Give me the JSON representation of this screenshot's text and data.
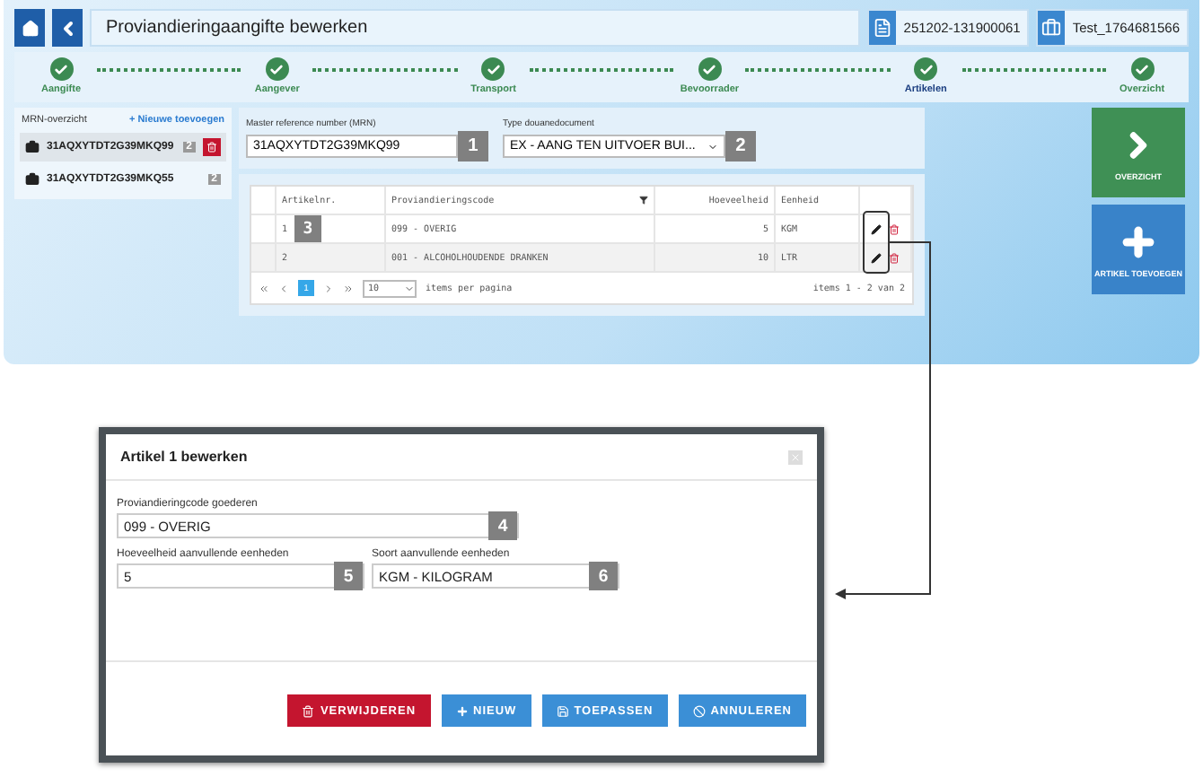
{
  "header": {
    "title": "Proviandieringaangifte bewerken",
    "document_number": "251202-131900061",
    "user": "Test_1764681566"
  },
  "steps": [
    {
      "label": "Aangifte",
      "selected": false
    },
    {
      "label": "Aangever",
      "selected": false
    },
    {
      "label": "Transport",
      "selected": false
    },
    {
      "label": "Bevoorrader",
      "selected": false
    },
    {
      "label": "Artikelen",
      "selected": true
    },
    {
      "label": "Overzicht",
      "selected": false
    }
  ],
  "sidebar": {
    "title": "MRN-overzicht",
    "add_link": "+ Nieuwe toevoegen",
    "items": [
      {
        "mrn": "31AQXYTDT2G39MKQ99",
        "count": "2",
        "selected": true
      },
      {
        "mrn": "31AQXYTDT2G39MKQ55",
        "count": "2",
        "selected": false
      }
    ]
  },
  "form": {
    "fields": [
      {
        "kind": "text",
        "label": "Master reference number (MRN)",
        "value": "31AQXYTDT2G39MKQ99",
        "marker": "1"
      },
      {
        "kind": "select",
        "label": "Type douanedocument",
        "value": "EX - AANG TEN UITVOER BUI...",
        "marker": "2"
      }
    ]
  },
  "table": {
    "columns": [
      {},
      {
        "label": "Artikelnr."
      },
      {
        "label": "Proviandieringscode",
        "filter": true
      },
      {
        "label": "Hoeveelheid"
      },
      {
        "label": "Eenheid"
      },
      {}
    ],
    "rows": [
      {
        "number": "1",
        "marker": "3",
        "code": "099 - OVERIG",
        "quantity": "5",
        "unit": "KGM"
      },
      {
        "number": "2",
        "code": "001 - ALCOHOLHOUDENDE DRANKEN",
        "quantity": "10",
        "unit": "LTR"
      }
    ],
    "pagination": {
      "pages": [
        {
          "label": "1",
          "selected": true
        }
      ],
      "page_size": "10",
      "per_page_label": "items per pagina",
      "summary": "items 1 - 2 van 2"
    }
  },
  "actions": [
    {
      "kind": "next",
      "label": "OVERZICHT"
    },
    {
      "kind": "add",
      "label": "ARTIKEL TOEVOEGEN"
    }
  ],
  "dialog": {
    "title": "Artikel 1 bewerken",
    "fields": [
      {
        "label": "Proviandieringcode goederen",
        "value": "099 - OVERIG",
        "marker": "4"
      },
      {
        "label": "Hoeveelheid aanvullende eenheden",
        "value": "5",
        "marker": "5"
      },
      {
        "label": "Soort aanvullende eenheden",
        "value": "KGM - KILOGRAM",
        "marker": "6"
      }
    ],
    "buttons": [
      {
        "kind": "delete",
        "label": "VERWIJDEREN"
      },
      {
        "kind": "new",
        "label": "NIEUW"
      },
      {
        "kind": "apply",
        "label": "TOEPASSEN"
      },
      {
        "kind": "cancel",
        "label": "ANNULEREN"
      }
    ]
  }
}
